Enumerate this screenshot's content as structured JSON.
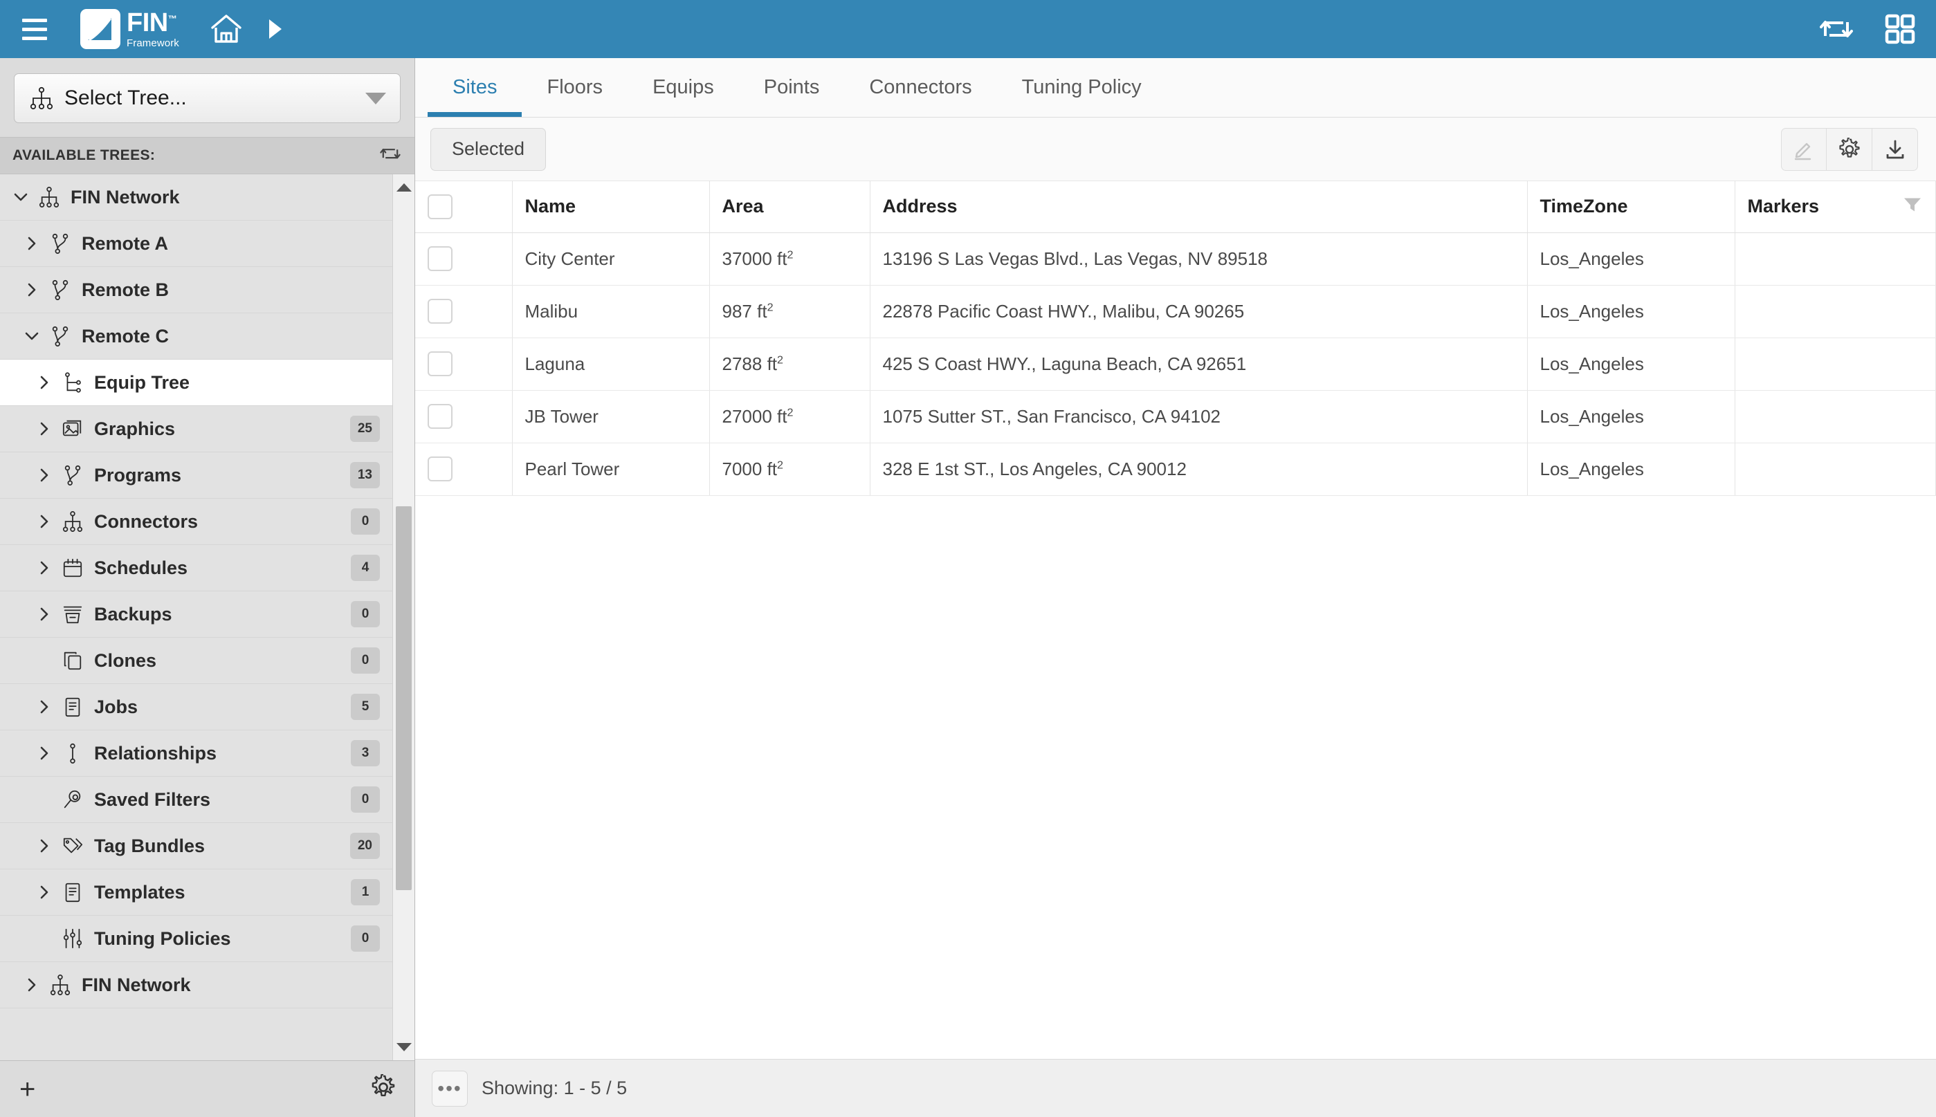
{
  "topbar": {
    "menu_icon": "hamburger-icon",
    "logo_name": "FIN",
    "logo_tm": "™",
    "logo_sub": "Framework",
    "home_icon": "home-icon",
    "forward_icon": "play-arrow-icon",
    "sync_icon": "sync-transfer-icon",
    "apps_icon": "grid-apps-icon"
  },
  "sidebar": {
    "tree_select_label": "Select Tree...",
    "tree_select_icon": "sitemap-icon",
    "available_header": "AVAILABLE TREES:",
    "available_sync_icon": "sync-transfer-icon",
    "add_label": "+",
    "settings_icon": "gear-icon",
    "items": [
      {
        "label": "FIN Network",
        "icon": "sitemap-icon",
        "level": 0,
        "twisty": "down",
        "badge": null,
        "selected": false
      },
      {
        "label": "Remote A",
        "icon": "branch-icon",
        "level": 1,
        "twisty": "right",
        "badge": null,
        "selected": false
      },
      {
        "label": "Remote B",
        "icon": "branch-icon",
        "level": 1,
        "twisty": "right",
        "badge": null,
        "selected": false
      },
      {
        "label": "Remote C",
        "icon": "branch-icon",
        "level": 1,
        "twisty": "down",
        "badge": null,
        "selected": false
      },
      {
        "label": "Equip Tree",
        "icon": "equip-tree-icon",
        "level": 2,
        "twisty": "right",
        "badge": null,
        "selected": true
      },
      {
        "label": "Graphics",
        "icon": "image-icon",
        "level": 2,
        "twisty": "right",
        "badge": "25",
        "selected": false
      },
      {
        "label": "Programs",
        "icon": "branch-icon",
        "level": 2,
        "twisty": "right",
        "badge": "13",
        "selected": false
      },
      {
        "label": "Connectors",
        "icon": "sitemap-icon",
        "level": 2,
        "twisty": "right",
        "badge": "0",
        "selected": false
      },
      {
        "label": "Schedules",
        "icon": "calendar-icon",
        "level": 2,
        "twisty": "right",
        "badge": "4",
        "selected": false
      },
      {
        "label": "Backups",
        "icon": "archive-icon",
        "level": 2,
        "twisty": "right",
        "badge": "0",
        "selected": false
      },
      {
        "label": "Clones",
        "icon": "copy-icon",
        "level": 2,
        "twisty": "none",
        "badge": "0",
        "selected": false
      },
      {
        "label": "Jobs",
        "icon": "document-icon",
        "level": 2,
        "twisty": "right",
        "badge": "5",
        "selected": false
      },
      {
        "label": "Relationships",
        "icon": "link-icon",
        "level": 2,
        "twisty": "right",
        "badge": "3",
        "selected": false
      },
      {
        "label": "Saved Filters",
        "icon": "search-icon",
        "level": 2,
        "twisty": "none",
        "badge": "0",
        "selected": false
      },
      {
        "label": "Tag Bundles",
        "icon": "tags-icon",
        "level": 2,
        "twisty": "right",
        "badge": "20",
        "selected": false
      },
      {
        "label": "Templates",
        "icon": "document-icon",
        "level": 2,
        "twisty": "right",
        "badge": "1",
        "selected": false
      },
      {
        "label": "Tuning Policies",
        "icon": "sliders-icon",
        "level": 2,
        "twisty": "none",
        "badge": "0",
        "selected": false
      },
      {
        "label": "FIN Network",
        "icon": "sitemap-icon",
        "level": 1,
        "twisty": "right",
        "badge": null,
        "selected": false
      }
    ]
  },
  "main": {
    "tabs": [
      {
        "label": "Sites",
        "active": true
      },
      {
        "label": "Floors",
        "active": false
      },
      {
        "label": "Equips",
        "active": false
      },
      {
        "label": "Points",
        "active": false
      },
      {
        "label": "Connectors",
        "active": false
      },
      {
        "label": "Tuning Policy",
        "active": false
      }
    ],
    "toolbar": {
      "selected_label": "Selected",
      "edit_icon": "pencil-edit-icon",
      "settings_icon": "gear-icon",
      "download_icon": "download-icon"
    },
    "table": {
      "columns": [
        "",
        "Name",
        "Area",
        "Address",
        "TimeZone",
        "Markers"
      ],
      "filter_icon": "filter-funnel-icon",
      "rows": [
        {
          "name": "City Center",
          "area": "37000 ft",
          "area_sup": "2",
          "address": "13196 S Las Vegas Blvd., Las Vegas, NV 89518",
          "timezone": "Los_Angeles",
          "markers": ""
        },
        {
          "name": "Malibu",
          "area": "987 ft",
          "area_sup": "2",
          "address": "22878 Pacific Coast HWY., Malibu, CA 90265",
          "timezone": "Los_Angeles",
          "markers": ""
        },
        {
          "name": "Laguna",
          "area": "2788 ft",
          "area_sup": "2",
          "address": "425 S Coast HWY., Laguna Beach, CA 92651",
          "timezone": "Los_Angeles",
          "markers": ""
        },
        {
          "name": "JB Tower",
          "area": "27000 ft",
          "area_sup": "2",
          "address": "1075 Sutter ST., San Francisco, CA 94102",
          "timezone": "Los_Angeles",
          "markers": ""
        },
        {
          "name": "Pearl Tower",
          "area": "7000 ft",
          "area_sup": "2",
          "address": "328 E 1st ST., Los Angeles, CA 90012",
          "timezone": "Los_Angeles",
          "markers": ""
        }
      ]
    },
    "footer": {
      "more_label": "•••",
      "showing_text": "Showing: 1 - 5 / 5"
    }
  },
  "colors": {
    "brand_blue": "#3486b5",
    "tab_active": "#2c7fb0",
    "sidebar_bg": "#dcdcdc",
    "tree_bg": "#e2e2e2",
    "badge_bg": "#cbcbcb"
  }
}
